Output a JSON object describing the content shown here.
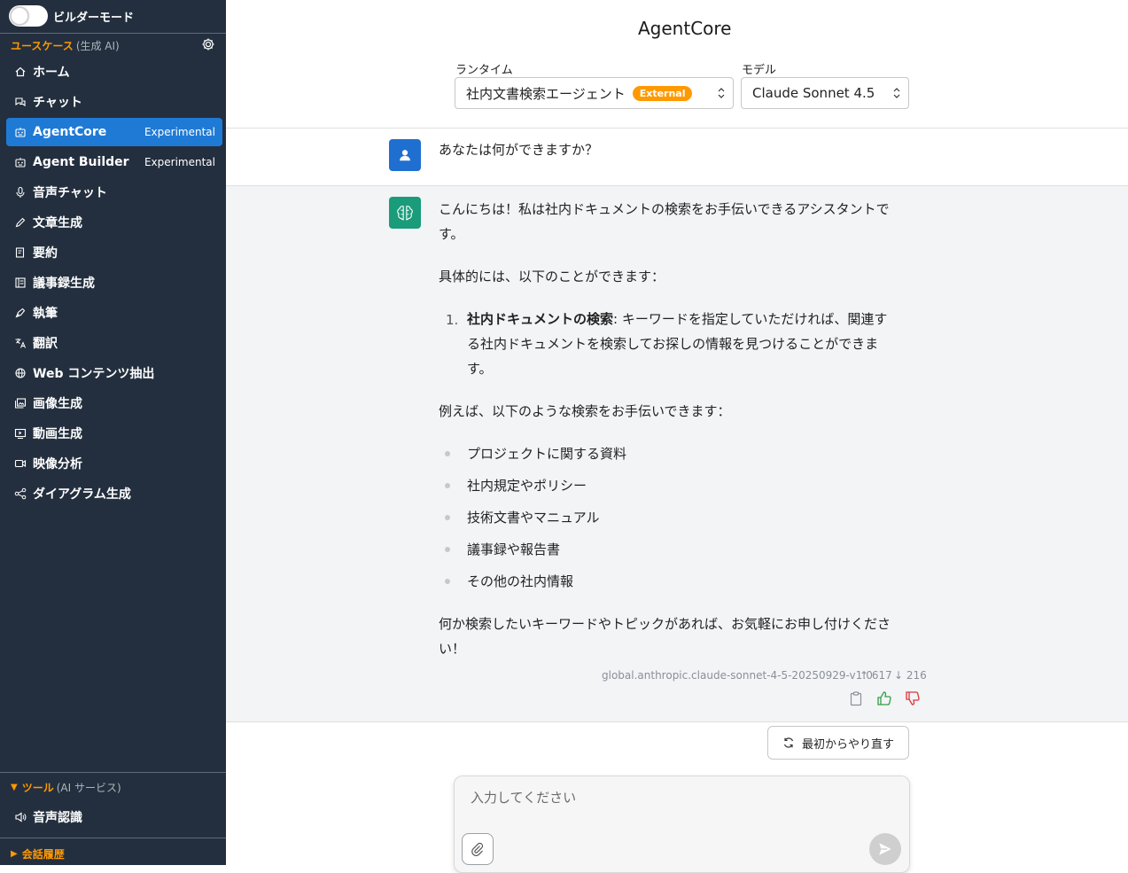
{
  "sidebar": {
    "builder_mode_label": "ビルダーモード",
    "usecase_header": "ユースケース",
    "usecase_sub": "(生成 AI)",
    "items": [
      {
        "label": "ホーム",
        "icon": "home-icon",
        "tag": ""
      },
      {
        "label": "チャット",
        "icon": "chat-icon",
        "tag": ""
      },
      {
        "label": "AgentCore",
        "icon": "robot-icon",
        "tag": "Experimental",
        "active": true
      },
      {
        "label": "Agent Builder",
        "icon": "robot-icon",
        "tag": "Experimental"
      },
      {
        "label": "音声チャット",
        "icon": "microphone-icon",
        "tag": ""
      },
      {
        "label": "文章生成",
        "icon": "pencil-icon",
        "tag": ""
      },
      {
        "label": "要約",
        "icon": "summary-icon",
        "tag": ""
      },
      {
        "label": "議事録生成",
        "icon": "minutes-icon",
        "tag": ""
      },
      {
        "label": "執筆",
        "icon": "pen-icon",
        "tag": ""
      },
      {
        "label": "翻訳",
        "icon": "translate-icon",
        "tag": ""
      },
      {
        "label": "Web コンテンツ抽出",
        "icon": "globe-icon",
        "tag": ""
      },
      {
        "label": "画像生成",
        "icon": "image-icon",
        "tag": ""
      },
      {
        "label": "動画生成",
        "icon": "video-icon",
        "tag": ""
      },
      {
        "label": "映像分析",
        "icon": "camera-icon",
        "tag": ""
      },
      {
        "label": "ダイアグラム生成",
        "icon": "diagram-icon",
        "tag": ""
      }
    ],
    "tools_header": "ツール",
    "tools_sub": "(AI サービス)",
    "tools_items": [
      {
        "label": "音声認識",
        "icon": "speaker-icon"
      }
    ],
    "history_header": "会話履歴"
  },
  "header": {
    "title": "AgentCore",
    "runtime_label": "ランタイム",
    "runtime_value": "社内文書検索エージェント",
    "runtime_badge": "External",
    "model_label": "モデル",
    "model_value": "Claude Sonnet 4.5"
  },
  "conversation": {
    "user_message": "あなたは何ができますか？",
    "bot": {
      "intro_line1": "こんにちは！私は社内ドキュメントの検索をお手伝いできるアシスタントで",
      "intro_line2": "す。",
      "specific": "具体的には、以下のことができます：",
      "list_number": "1.",
      "list_bold": "社内ドキュメントの検索",
      "list_line1_rest": ": キーワードを指定していただければ、関連す",
      "list_line2": "る社内ドキュメントを検索してお探しの情報を見つけることができま",
      "list_line3": "す。",
      "example": "例えば、以下のような検索をお手伝いできます：",
      "bullets": [
        "プロジェクトに関する資料",
        "社内規定やポリシー",
        "技術文書やマニュアル",
        "議事録や報告書",
        "その他の社内情報"
      ],
      "closing_line1": "何か検索したいキーワードやトピックがあれば、お気軽にお申し付けくださ",
      "closing_line2": "い！",
      "model_id": "global.anthropic.claude-sonnet-4-5-20250929-v1:0",
      "tokens_in": "617",
      "tokens_out": "216"
    }
  },
  "reset_button": "最初からやり直す",
  "input": {
    "placeholder": "入力してください",
    "value": ""
  },
  "colors": {
    "sidebar_bg": "#232f3e",
    "accent_orange": "#ff9900",
    "active_blue": "#1f7ad6",
    "bot_bg": "#f3f4f6"
  }
}
